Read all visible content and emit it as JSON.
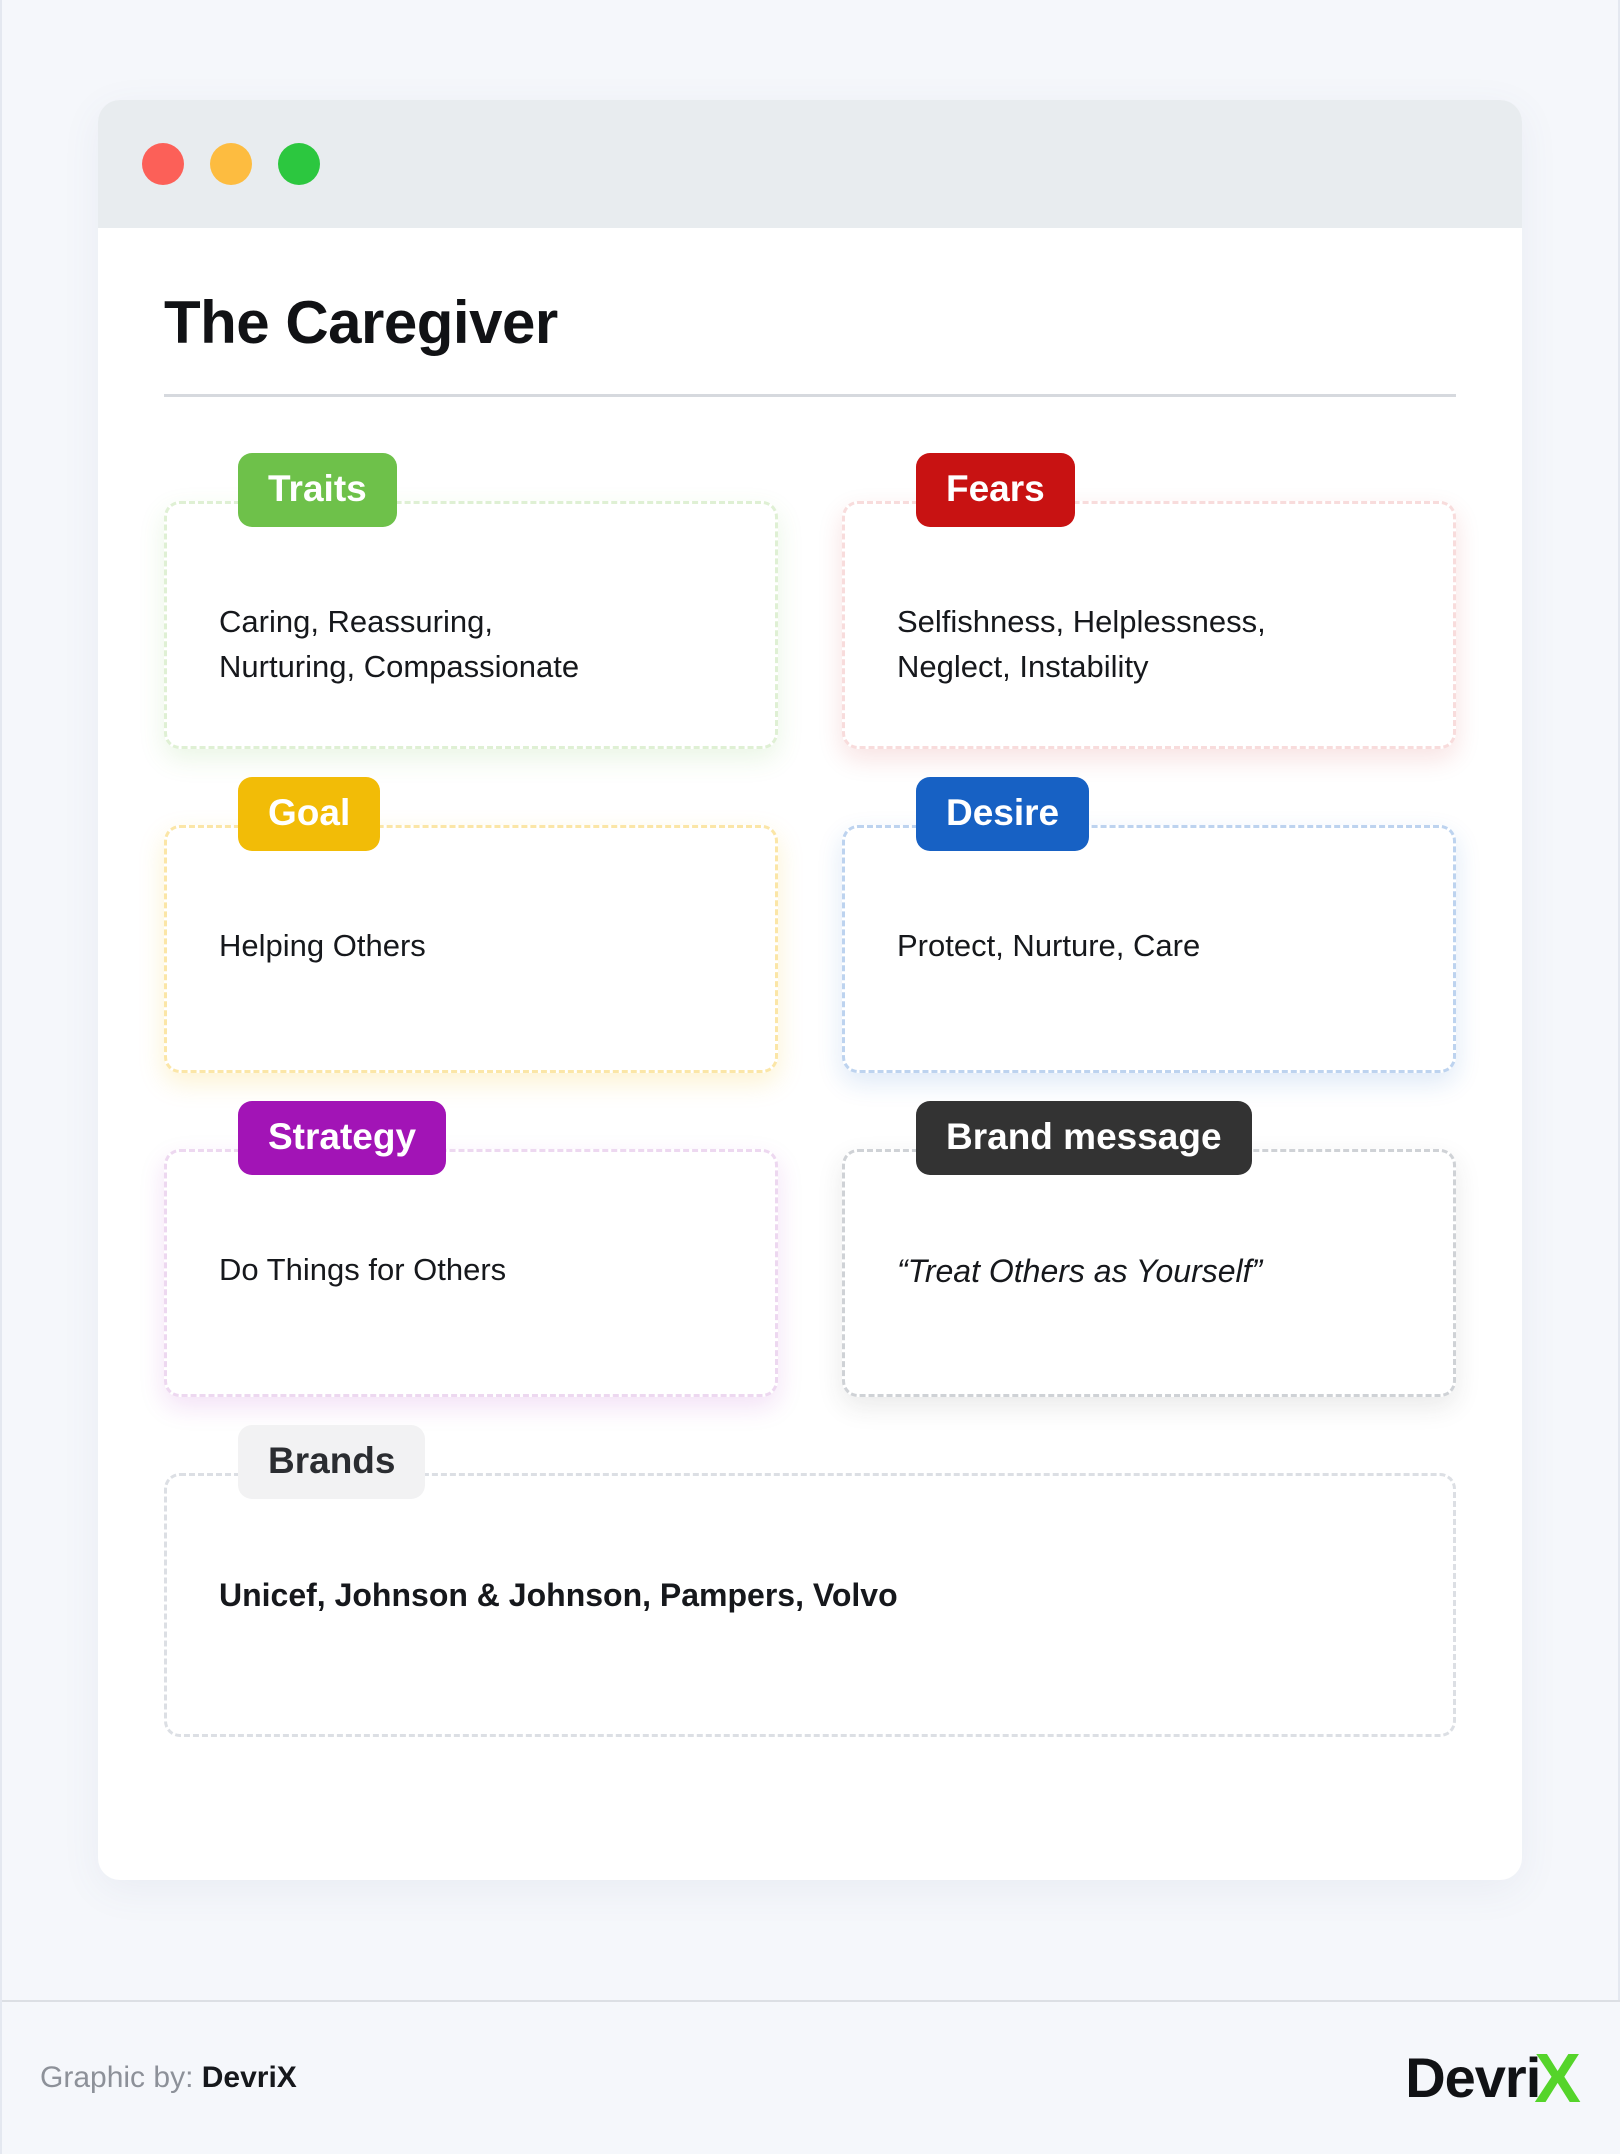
{
  "window": {
    "traffic_lights": [
      "close-dot",
      "minimize-dot",
      "maximize-dot"
    ]
  },
  "header": {
    "title": "The Caregiver"
  },
  "cards": [
    {
      "badge": "Traits",
      "text": "Caring, Reassuring,\nNurturing, Compassionate",
      "accent": "#6EC14A",
      "border": "#DFF0D4"
    },
    {
      "badge": "Fears",
      "text": "Selfishness, Helplessness,\nNeglect, Instability",
      "accent": "#C81212",
      "border": "#F8DCDC"
    },
    {
      "badge": "Goal",
      "text": "Helping Others",
      "accent": "#F2BC07",
      "border": "#FBE6A7"
    },
    {
      "badge": "Desire",
      "text": "Protect, Nurture, Care",
      "accent": "#1761C4",
      "border": "#BDD3EF"
    },
    {
      "badge": "Strategy",
      "text": "Do Things for Others",
      "accent": "#A214B6",
      "border": "#EDD8F0"
    },
    {
      "badge": "Brand message",
      "text": "“Treat Others as Yourself”",
      "accent": "#333333",
      "border": "#CFD2D6"
    },
    {
      "badge": "Brands",
      "text": "Unicef, Johnson & Johnson, Pampers, Volvo",
      "accent": "#F2F2F3",
      "border": "#DCDFE4"
    }
  ],
  "footer": {
    "credit_prefix": "Graphic by:",
    "credit_name": "DevriX",
    "logo_text": "Devri",
    "logo_accent_char": "X",
    "logo_accent_color": "#55D42A"
  }
}
